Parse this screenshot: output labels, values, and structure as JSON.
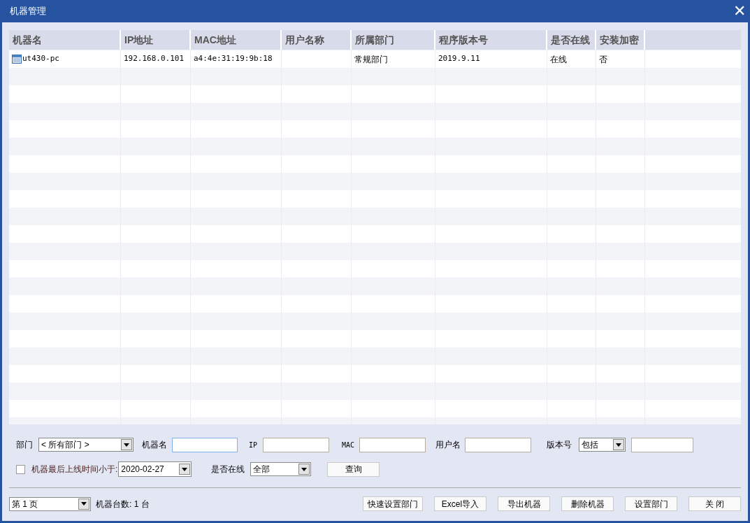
{
  "window": {
    "title": "机器管理",
    "close": "✕"
  },
  "table": {
    "columns": [
      "机器名",
      "IP地址",
      "MAC地址",
      "用户名称",
      "所属部门",
      "程序版本号",
      "是否在线",
      "安装加密"
    ],
    "rows": [
      {
        "cells": [
          "ut430-pc",
          "192.168.0.101",
          "a4:4e:31:19:9b:18",
          null,
          "常规部门",
          "2019.9.11",
          "在线",
          "否"
        ]
      }
    ]
  },
  "filters": {
    "department": {
      "label": "部门",
      "value": "< 所有部门 >"
    },
    "machine_name": {
      "label": "机器名",
      "focused": true
    },
    "ip": {
      "label": "IP"
    },
    "mac": {
      "label": "MAC"
    },
    "user_name": {
      "label": "用户名"
    },
    "version": {
      "label": "版本号",
      "mode": "包括"
    },
    "last_online": {
      "label": "机器最后上线时间小于:",
      "checked": false,
      "value": "2020-02-27"
    },
    "online": {
      "label": "是否在线",
      "value": "全部"
    },
    "query_button": "查询"
  },
  "footer": {
    "page": "第 1 页",
    "count": "机器台数: 1 台",
    "buttons": [
      "快速设置部门",
      "Excel导入",
      "导出机器",
      "删除机器",
      "设置部门",
      "关 闭"
    ]
  }
}
